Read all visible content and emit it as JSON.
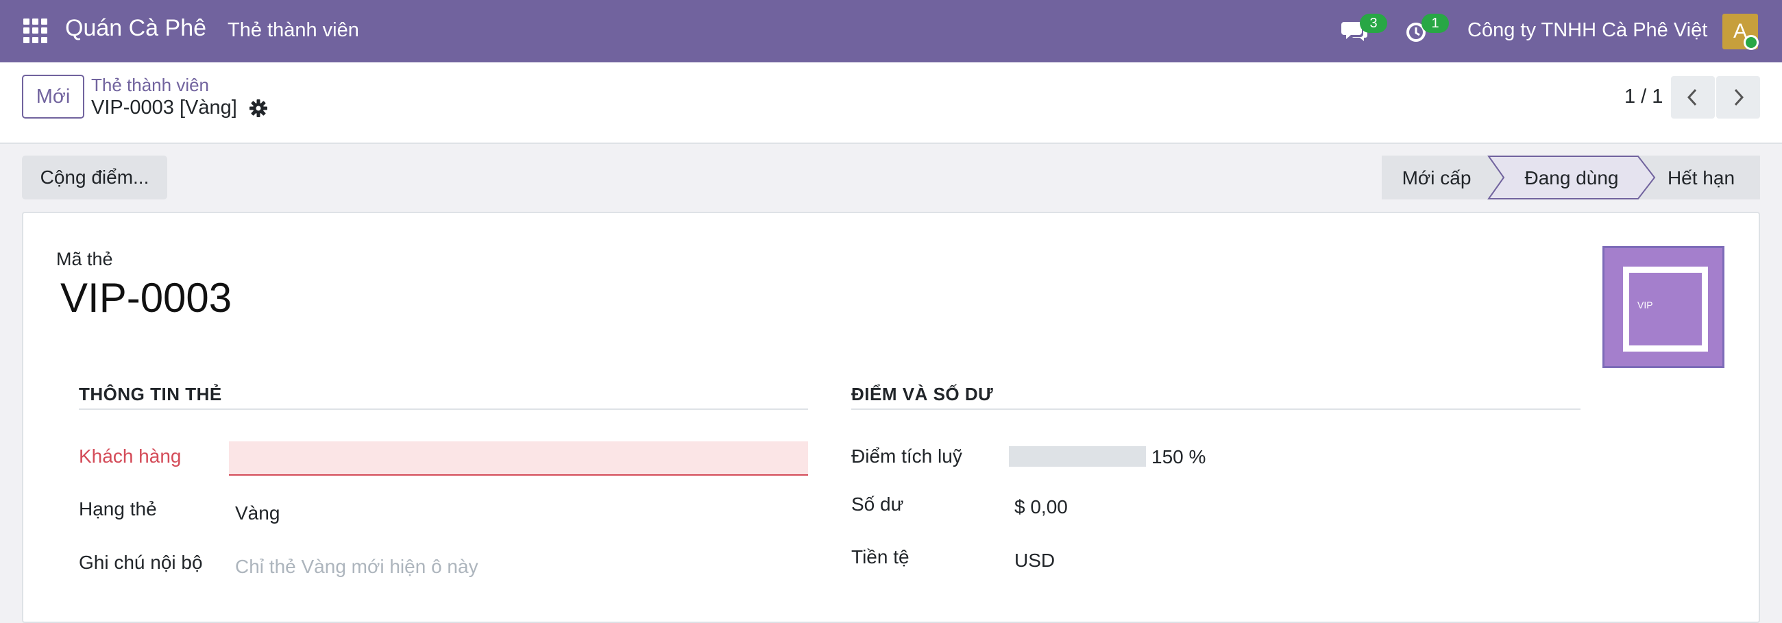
{
  "navbar": {
    "brand": "Quán Cà Phê",
    "menu": "Thẻ thành viên",
    "messages_count": "3",
    "activities_count": "1",
    "company": "Công ty TNHH Cà Phê Việt",
    "avatar_letter": "A",
    "bg_color": "#71639e"
  },
  "control": {
    "new_button": "Mới",
    "breadcrumb_parent": "Thẻ thành viên",
    "breadcrumb_current": "VIP-0003 [Vàng]",
    "pager": "1 / 1"
  },
  "actions": {
    "add_points": "Cộng điểm..."
  },
  "statusbar": {
    "stages": [
      "Mới cấp",
      "Đang dùng",
      "Hết hạn"
    ],
    "active_stage": "Đang dùng"
  },
  "form": {
    "name_caption": "Mã thẻ",
    "name": "VIP-0003",
    "image_text": "VIP",
    "left_section": {
      "title": "THÔNG TIN THẺ",
      "customer_label": "Khách hàng",
      "customer_value": "",
      "tier_label": "Hạng thẻ",
      "tier_value": "Vàng",
      "note_label": "Ghi chú nội bộ",
      "note_placeholder": "Chỉ thẻ Vàng mới hiện ô này"
    },
    "right_section": {
      "title": "ĐIỂM VÀ SỐ DƯ",
      "points_label": "Điểm tích luỹ",
      "points_percent": "150 %",
      "points_fraction": 1.5,
      "balance_label": "Số dư",
      "balance_value": "$ 0,00",
      "currency_label": "Tiền tệ",
      "currency_value": "USD"
    }
  }
}
